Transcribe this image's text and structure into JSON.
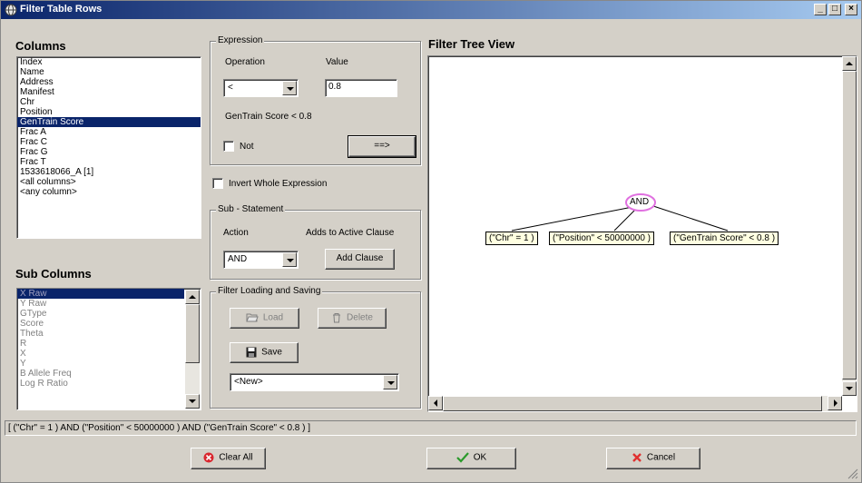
{
  "window": {
    "title": "Filter Table Rows",
    "controls": {
      "minimize": "_",
      "maximize": "□",
      "close": "×"
    }
  },
  "columns": {
    "heading": "Columns",
    "items": [
      "Index",
      "Name",
      "Address",
      "Manifest",
      "Chr",
      "Position",
      "GenTrain Score",
      "Frac A",
      "Frac C",
      "Frac G",
      "Frac T",
      "1533618066_A [1]",
      "<all columns>",
      "<any column>"
    ],
    "selected": "GenTrain Score"
  },
  "sub_columns": {
    "heading": "Sub Columns",
    "items": [
      "X Raw",
      "Y Raw",
      "GType",
      "Score",
      "Theta",
      "R",
      "X",
      "Y",
      "B Allele Freq",
      "Log R Ratio"
    ],
    "selected": "X Raw"
  },
  "expression": {
    "group_title": "Expression",
    "operation_label": "Operation",
    "value_label": "Value",
    "operation_value": "<",
    "value_input": "0.8",
    "preview": "GenTrain Score < 0.8",
    "not_label": "Not",
    "insert_button": "==>"
  },
  "invert_label": "Invert Whole Expression",
  "sub_statement": {
    "group_title": "Sub - Statement",
    "action_label": "Action",
    "adds_label": "Adds to Active Clause",
    "action_value": "AND",
    "add_clause_button": "Add Clause"
  },
  "loading": {
    "group_title": "Filter Loading and Saving",
    "load_button": "Load",
    "delete_button": "Delete",
    "save_button": "Save",
    "filter_select": "<New>"
  },
  "tree": {
    "heading": "Filter Tree View",
    "root": "AND",
    "leaves": [
      "(\"Chr\" = 1 )",
      "(\"Position\" < 50000000 )",
      "(\"GenTrain Score\" < 0.8 )"
    ]
  },
  "status_expression": "[ (\"Chr\" = 1 ) AND (\"Position\" < 50000000 ) AND (\"GenTrain Score\" < 0.8 ) ]",
  "footer": {
    "clear_all": "Clear All",
    "ok": "OK",
    "cancel": "Cancel"
  },
  "colors": {
    "selection": "#0a246a",
    "node_fill": "#ffffe1",
    "root_outline": "#e070e0"
  }
}
